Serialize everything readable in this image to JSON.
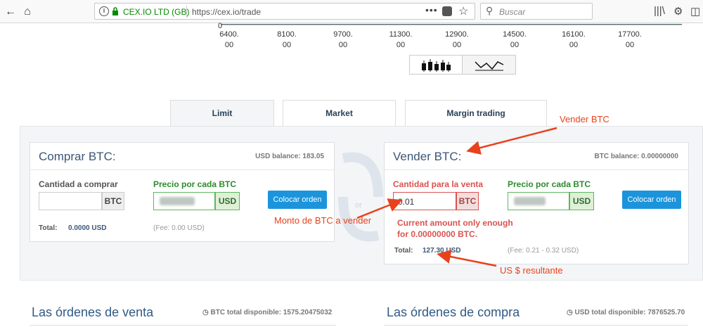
{
  "browser": {
    "site_identity": "CEX.IO LTD (GB)",
    "url": "https://cex.io/trade",
    "search_placeholder": "Buscar"
  },
  "chart": {
    "zero_label": "0",
    "x_ticks": [
      "6400.\n00",
      "8100.\n00",
      "9700.\n00",
      "11300.\n00",
      "12900.\n00",
      "14500.\n00",
      "16100.\n00",
      "17700.\n00"
    ]
  },
  "tabs": [
    {
      "label": "Limit",
      "active": true
    },
    {
      "label": "Market",
      "active": false
    },
    {
      "label": "Margin trading",
      "active": false
    }
  ],
  "buy": {
    "title": "Comprar BTC:",
    "balance": "USD balance: 183.05",
    "amount_label": "Cantidad a comprar",
    "amount_value": "",
    "amount_unit": "BTC",
    "price_label": "Precio por cada BTC",
    "price_unit": "USD",
    "button": "Colocar orden",
    "total_label": "Total:",
    "total_value": "0.0000 USD",
    "fee": "(Fee: 0.00 USD)"
  },
  "sell": {
    "title": "Vender BTC:",
    "balance": "BTC balance: 0.00000000",
    "amount_label": "Cantidad para la venta",
    "amount_value": "0.01",
    "amount_unit": "BTC",
    "price_label": "Precio por cada BTC",
    "price_unit": "USD",
    "button": "Colocar orden",
    "error": "Current amount only enough for 0.00000000 BTC.",
    "total_label": "Total:",
    "total_value": "127.30 USD",
    "fee": "(Fee: 0.21 - 0.32 USD)"
  },
  "annotations": {
    "sell": "Vender BTC",
    "amount": "Monto de BTC a vender",
    "result": "US $ resultante"
  },
  "orders": {
    "sell_title": "Las órdenes de venta",
    "sell_available": "BTC total disponible: 1575.20475032",
    "buy_title": "Las órdenes de compra",
    "buy_available": "USD total disponible: 7876525.70"
  },
  "colors": {
    "accent": "#1b94dc",
    "error": "#e8421c",
    "green": "#2e8b2e"
  }
}
